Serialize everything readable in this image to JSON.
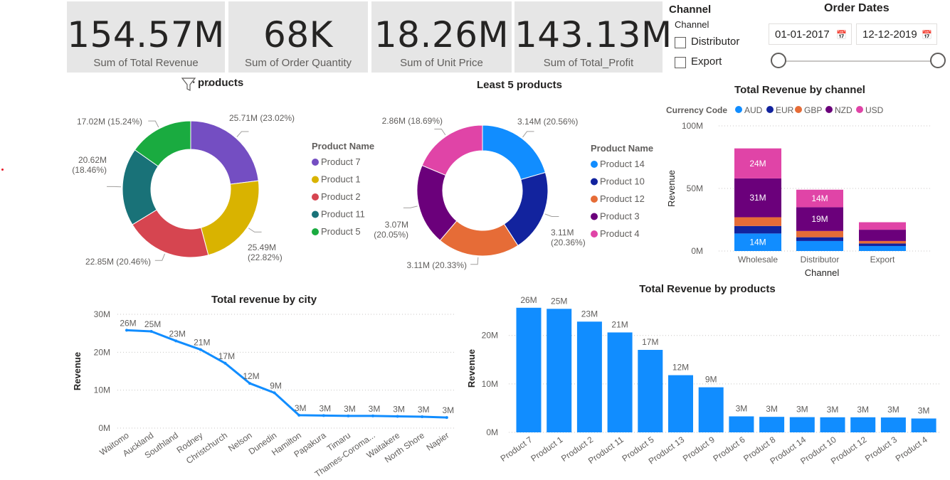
{
  "cards": [
    {
      "value": "154.57M",
      "label": "Sum of Total Revenue"
    },
    {
      "value": "68K",
      "label": "Sum of Order Quantity"
    },
    {
      "value": "18.26M",
      "label": "Sum of Unit Price"
    },
    {
      "value": "143.13M",
      "label": "Sum of Total_Profit"
    }
  ],
  "channel_slicer": {
    "title": "Channel",
    "header": "Channel",
    "options": [
      {
        "label": "Distributor",
        "checked": false
      },
      {
        "label": "Export",
        "checked": false
      }
    ]
  },
  "date_slicer": {
    "title": "Order Dates",
    "start": "01-01-2017",
    "end": "12-12-2019",
    "range_fraction": [
      0,
      1
    ]
  },
  "icons": {
    "filter": "filter-icon",
    "more": "more-options-icon",
    "calendar": "calendar-icon"
  },
  "more_glyph": "...",
  "chart_data": [
    {
      "id": "top5",
      "type": "pie",
      "title": "ᐧ products",
      "legend_title": "Product Name",
      "labels": [
        "Product 7",
        "Product 1",
        "Product 2",
        "Product 11",
        "Product 5"
      ],
      "values": [
        25.71,
        25.49,
        22.85,
        20.62,
        17.02
      ],
      "percents": [
        23.02,
        22.82,
        20.46,
        18.46,
        15.24
      ],
      "data_labels": [
        "25.71M (23.02%)",
        "25.49M (22.82%)",
        "22.85M (20.46%)",
        "20.62M (18.46%)",
        "17.02M (15.24%)"
      ],
      "colors": [
        "#744ec2",
        "#d9b300",
        "#d64550",
        "#197278",
        "#1aab40"
      ],
      "donut": true
    },
    {
      "id": "least5",
      "type": "pie",
      "title": "Least 5 products",
      "legend_title": "Product Name",
      "labels": [
        "Product 14",
        "Product 10",
        "Product 12",
        "Product 3",
        "Product 4"
      ],
      "values": [
        3.14,
        3.11,
        3.11,
        3.07,
        2.86
      ],
      "percents": [
        20.56,
        20.36,
        20.33,
        20.05,
        18.69
      ],
      "data_labels": [
        "3.14M (20.56%)",
        "3.11M (20.36%)",
        "3.11M (20.33%)",
        "3.07M (20.05%)",
        "2.86M (18.69%)"
      ],
      "colors": [
        "#118dff",
        "#12239e",
        "#e66c37",
        "#6b007b",
        "#e044a7"
      ],
      "donut": true
    },
    {
      "id": "by_channel",
      "type": "bar",
      "stacked": true,
      "title": "Total Revenue by channel",
      "legend_title": "Currency Code",
      "categories": [
        "Wholesale",
        "Distributor",
        "Export"
      ],
      "xlabel": "Channel",
      "ylabel": "Revenue",
      "yticks": [
        "0M",
        "50M",
        "100M"
      ],
      "ylim": [
        0,
        100
      ],
      "series": [
        {
          "name": "AUD",
          "color": "#118dff",
          "values": [
            14,
            8,
            4
          ],
          "labels": [
            "14M",
            "",
            ""
          ]
        },
        {
          "name": "EUR",
          "color": "#12239e",
          "values": [
            6,
            3,
            2
          ],
          "labels": [
            "",
            "",
            ""
          ]
        },
        {
          "name": "GBP",
          "color": "#e66c37",
          "values": [
            7,
            5,
            2
          ],
          "labels": [
            "",
            "",
            ""
          ]
        },
        {
          "name": "NZD",
          "color": "#6b007b",
          "values": [
            31,
            19,
            9
          ],
          "labels": [
            "31M",
            "19M",
            ""
          ]
        },
        {
          "name": "USD",
          "color": "#e044a7",
          "values": [
            24,
            14,
            6
          ],
          "labels": [
            "24M",
            "14M",
            ""
          ]
        }
      ]
    },
    {
      "id": "by_city",
      "type": "line",
      "title": "Total revenue by city",
      "ylabel": "Revenue",
      "yticks": [
        "0M",
        "10M",
        "20M",
        "30M"
      ],
      "ylim": [
        0,
        30
      ],
      "categories": [
        "Waitomo",
        "Auckland",
        "Southland",
        "Rodney",
        "Christchurch",
        "Nelson",
        "Dunedin",
        "Hamilton",
        "Papakura",
        "Timaru",
        "Thames-Coroma...",
        "Waitakere",
        "North Shore",
        "Napier"
      ],
      "values": [
        25.8,
        25.5,
        23,
        20.7,
        17.1,
        11.8,
        9.3,
        3.4,
        3.3,
        3.2,
        3.2,
        3.1,
        3.0,
        2.8
      ],
      "data_labels": [
        "26M",
        "25M",
        "23M",
        "21M",
        "17M",
        "12M",
        "9M",
        "3M",
        "3M",
        "3M",
        "3M",
        "3M",
        "3M",
        "3M"
      ],
      "color": "#118dff"
    },
    {
      "id": "by_products",
      "type": "bar",
      "title": "Total Revenue by products",
      "ylabel": "Revenue",
      "yticks": [
        "0M",
        "10M",
        "20M"
      ],
      "ylim": [
        0,
        27
      ],
      "categories": [
        "Product 7",
        "Product 1",
        "Product 2",
        "Product 11",
        "Product 5",
        "Product 13",
        "Product 9",
        "Product 6",
        "Product 8",
        "Product 14",
        "Product 10",
        "Product 12",
        "Product 3",
        "Product 4"
      ],
      "values": [
        25.71,
        25.49,
        22.85,
        20.62,
        17.02,
        11.8,
        9.3,
        3.3,
        3.2,
        3.14,
        3.11,
        3.11,
        3.07,
        2.86
      ],
      "data_labels": [
        "26M",
        "25M",
        "23M",
        "21M",
        "17M",
        "12M",
        "9M",
        "3M",
        "3M",
        "3M",
        "3M",
        "3M",
        "3M",
        "3M"
      ],
      "color": "#118dff"
    }
  ]
}
